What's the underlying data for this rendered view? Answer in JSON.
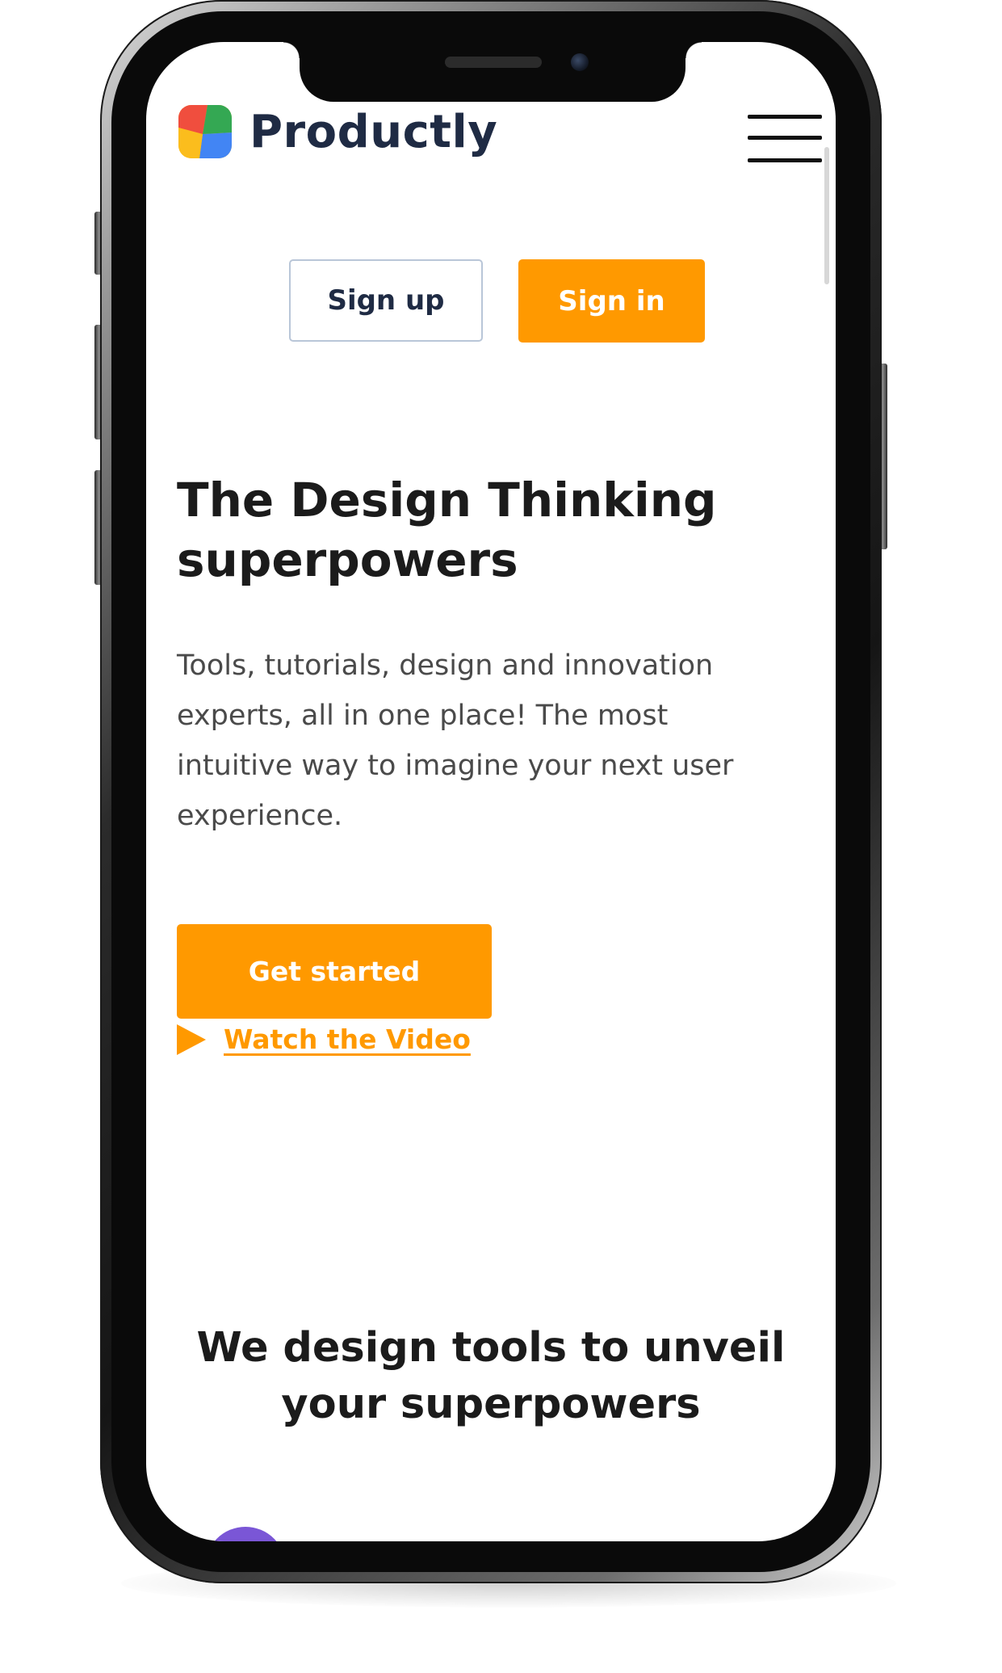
{
  "brand": {
    "name": "Productly",
    "logo_icon": "productly-logo-icon"
  },
  "nav": {
    "menu_icon": "hamburger-menu-icon"
  },
  "auth": {
    "signup_label": "Sign up",
    "signin_label": "Sign in"
  },
  "hero": {
    "title_line1": "The Design Thinking",
    "title_line2": "superpowers",
    "description_line1": "Tools, tutorials, design and innovation",
    "description_line2": "experts, all in one place! The most",
    "description_line3": "intuitive way to imagine your next user",
    "description_line4": "experience.",
    "cta_label": "Get started",
    "video_label": "Watch the Video",
    "video_icon": "play-icon"
  },
  "section": {
    "title_line1": "We design tools to unveil",
    "title_line2": "your superpowers"
  },
  "colors": {
    "accent": "#ff9900",
    "brand_text": "#1f2b44",
    "heading": "#1b1b1b",
    "body_text": "#4a4a4a",
    "signup_border": "#b9c6d8"
  }
}
